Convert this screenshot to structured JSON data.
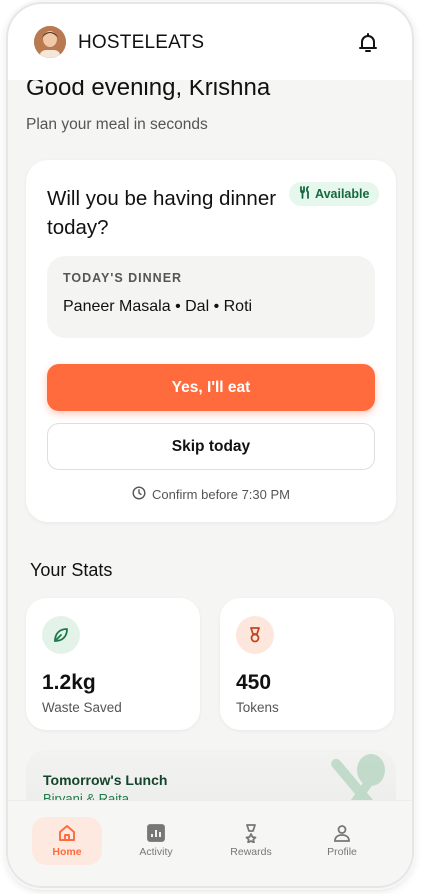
{
  "header": {
    "brand": "HOSTELEATS"
  },
  "greeting": {
    "title": "Good evening, Krishna",
    "subtitle": "Plan your meal in seconds"
  },
  "dinner_card": {
    "question": "Will you be having dinner today?",
    "badge": "Available",
    "label": "TODAY'S DINNER",
    "menu": "Paneer Masala • Dal • Roti",
    "yes_label": "Yes, I'll eat",
    "skip_label": "Skip today",
    "confirm_text": "Confirm before 7:30 PM"
  },
  "stats": {
    "title": "Your Stats",
    "items": [
      {
        "value": "1.2kg",
        "label": "Waste Saved",
        "icon": "leaf-icon"
      },
      {
        "value": "450",
        "label": "Tokens",
        "icon": "medal-icon"
      }
    ]
  },
  "tomorrow": {
    "title": "Tomorrow's Lunch",
    "menu": "Biryani & Raita"
  },
  "nav": [
    {
      "label": "Home",
      "icon": "home-icon",
      "active": true
    },
    {
      "label": "Activity",
      "icon": "activity-icon",
      "active": false
    },
    {
      "label": "Rewards",
      "icon": "rewards-icon",
      "active": false
    },
    {
      "label": "Profile",
      "icon": "profile-icon",
      "active": false
    }
  ],
  "colors": {
    "accent": "#ff6b3d",
    "success": "#16693f",
    "success_bg": "#e6f7ee"
  }
}
